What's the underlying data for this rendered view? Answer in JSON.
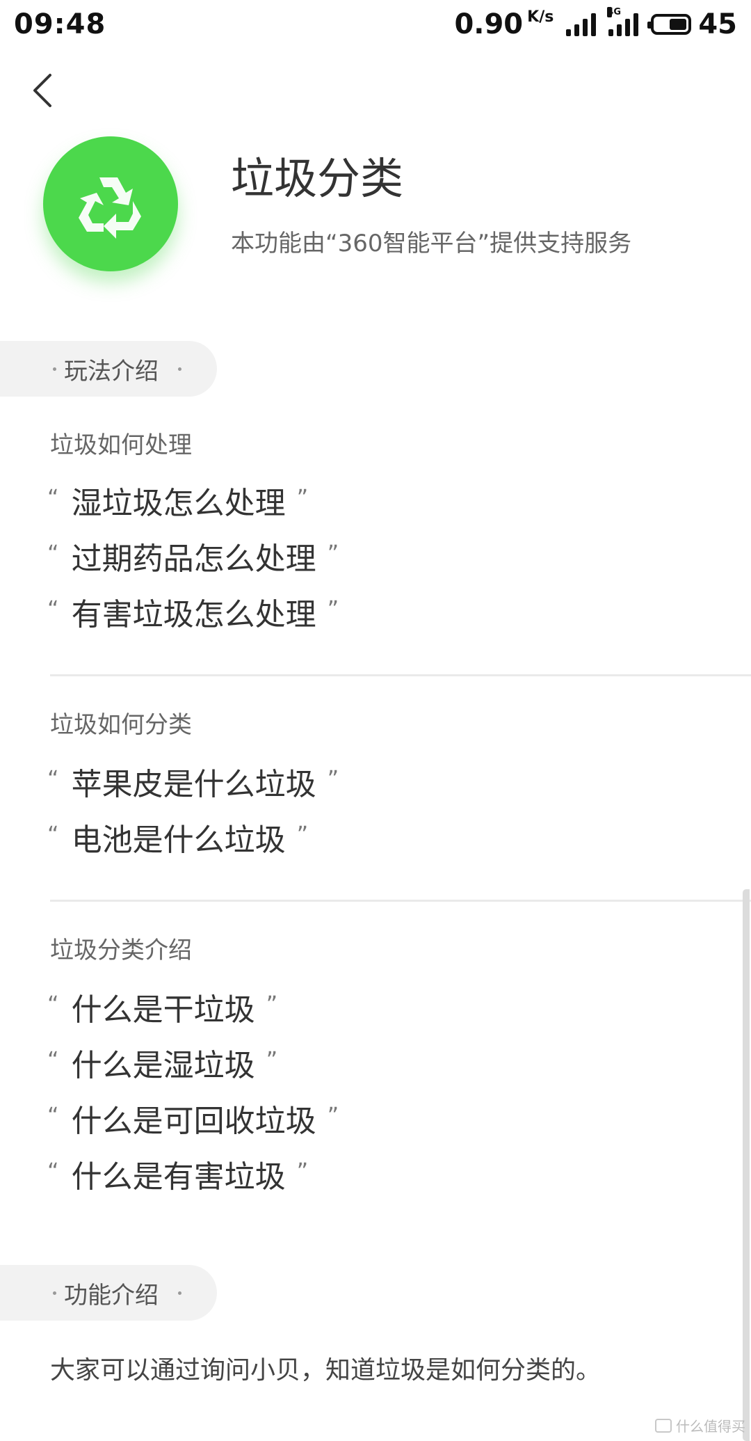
{
  "status_bar": {
    "time": "09:48",
    "net_speed": "0.90",
    "net_unit": "K/s",
    "network_type": "4G",
    "battery_level": "45"
  },
  "header": {
    "icon": "recycle-icon",
    "title": "垃圾分类",
    "subtitle": "本功能由“360智能平台”提供支持服务"
  },
  "sections": {
    "gameplay": {
      "label": "玩法介绍",
      "groups": [
        {
          "title": "垃圾如何处理",
          "examples": [
            "湿垃圾怎么处理",
            "过期药品怎么处理",
            "有害垃圾怎么处理"
          ]
        },
        {
          "title": "垃圾如何分类",
          "examples": [
            "苹果皮是什么垃圾",
            "电池是什么垃圾"
          ]
        },
        {
          "title": "垃圾分类介绍",
          "examples": [
            "什么是干垃圾",
            "什么是湿垃圾",
            "什么是可回收垃圾",
            "什么是有害垃圾"
          ]
        }
      ]
    },
    "feature": {
      "label": "功能介绍",
      "description": "大家可以通过询问小贝，知道垃圾是如何分类的。"
    }
  },
  "quotes": {
    "open": "“",
    "close": "”"
  },
  "watermark": "什么值得买",
  "colors": {
    "icon_green": "#4cd84c",
    "pill_bg": "#f2f2f2"
  }
}
